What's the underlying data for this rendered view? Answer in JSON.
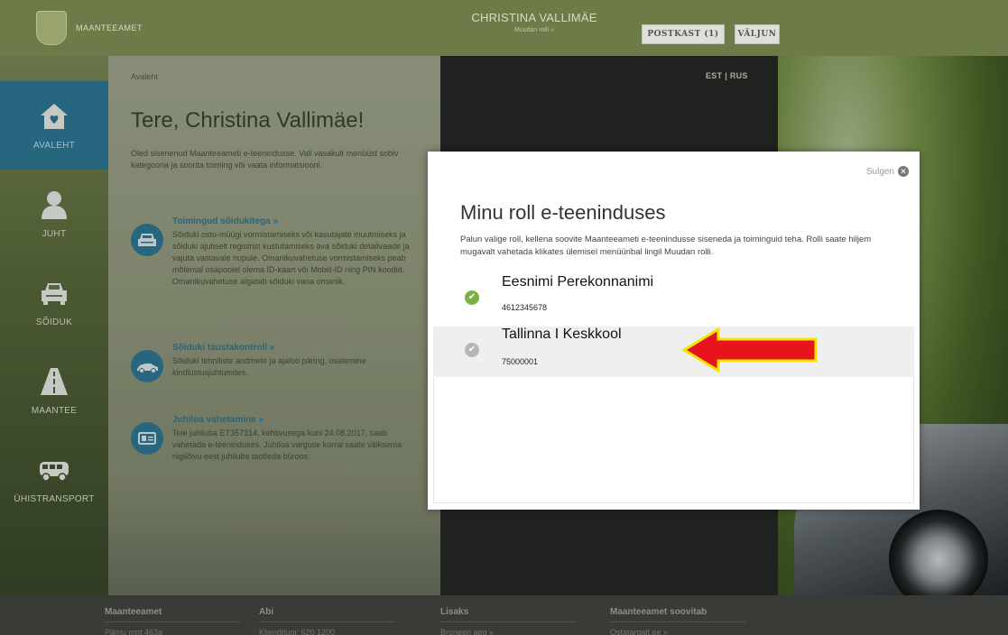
{
  "header": {
    "brand_name": "Maanteeamet",
    "user_name": "CHRISTINA VALLIMÄE",
    "change_role_label": "Muudan rolli »",
    "mailbox_label": "POSTKAST (1)",
    "logout_label": "VÄLJUN"
  },
  "sidebar": {
    "items": [
      {
        "label": "AVALEHT",
        "icon": "home-icon",
        "active": true
      },
      {
        "label": "JUHT",
        "icon": "person-icon",
        "active": false
      },
      {
        "label": "SÕIDUK",
        "icon": "car-icon",
        "active": false
      },
      {
        "label": "MAANTEE",
        "icon": "road-icon",
        "active": false
      },
      {
        "label": "ÜHISTRANSPORT",
        "icon": "bus-icon",
        "active": false
      }
    ]
  },
  "main": {
    "breadcrumb": "Avaleht",
    "greeting": "Tere, Christina Vallimäe!",
    "intro": "Oled sisenenud Maanteeameti e-teenindusse. Vali vasakult menüüst sobiv kategooria ja sooritа toiming või vaata informatsiooni.",
    "services": [
      {
        "title": "Toimingud sõidukitega »",
        "text": "Sõiduki ostu-müügi vormistamiseks või kasutajate muutmiseks ja sõiduki ajutiselt registrist kustutamiseks ava sõiduki detailvaade ja vajuta vastavale nupule. Omanikuvahetuse vormistamiseks peab mõlemal osapoolel olema ID-kaart või Mobiil-ID ning PIN koodid. Omanikuvahetuse algatab sõiduki vana omanik.",
        "icon": "car-front-icon"
      },
      {
        "title": "Sõiduki taustakontroll »",
        "text": "Sõiduki tehniliste andmete ja ajaloo päring, osalemine kindlustusjuhtumites.",
        "icon": "car-side-icon"
      },
      {
        "title": "Juhiloa vahetamine »",
        "text": "Teie juhiluba ET357314, kehtivusega kuni 24.08.2017, saab vahetada e-teeninduses. Juhiloa varguse korral saate väiksema riigilõivu eest juhiluba taotleda bürоos.",
        "icon": "id-card-icon"
      }
    ]
  },
  "lang": "EST | RUS",
  "modal": {
    "close_label": "Sulgen",
    "title": "Minu roll e-teeninduses",
    "description": "Palun valige roll, kellena soovite Maanteeameti e-teenindusse siseneda ja toiminguid teha. Rolli saate hiljem mugavalt vahetada klikates ülemisel menüüribal lingil Muudan rolli.",
    "roles": [
      {
        "name": "Eesnimi Perekonnanimi",
        "code": "4612345678",
        "selected": true
      },
      {
        "name": "Tallinna I Keskkool",
        "code": "75000001",
        "selected": false
      }
    ]
  },
  "footer": {
    "columns": [
      {
        "title": "Maanteeamet",
        "line": "Pärnu mnt 463a"
      },
      {
        "title": "Abi",
        "line": "Klienditugi: 620 1200"
      },
      {
        "title": "Lisaks",
        "line": "Broneeri aeg »"
      },
      {
        "title": "Maanteeamet soovitab",
        "line": "Ostatargalt.ee »"
      }
    ]
  },
  "colors": {
    "header_bg": "#6d7b49",
    "accent_blue": "#2f7d9a",
    "check_green": "#7ab343",
    "arrow_red": "#e8141b",
    "arrow_outline": "#f5e500"
  }
}
